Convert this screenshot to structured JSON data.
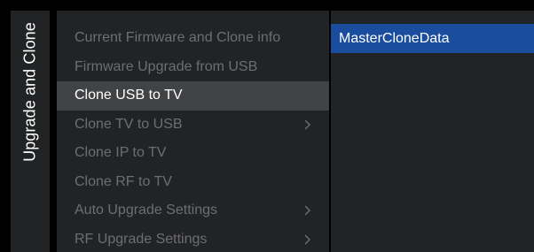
{
  "section_title": "Upgrade and Clone",
  "menu": {
    "items": [
      {
        "label": "Current Firmware and Clone info",
        "has_submenu": false,
        "selected": false
      },
      {
        "label": "Firmware Upgrade from USB",
        "has_submenu": false,
        "selected": false
      },
      {
        "label": "Clone USB to TV",
        "has_submenu": false,
        "selected": true
      },
      {
        "label": "Clone TV to USB",
        "has_submenu": true,
        "selected": false
      },
      {
        "label": "Clone IP to TV",
        "has_submenu": false,
        "selected": false
      },
      {
        "label": "Clone RF to TV",
        "has_submenu": false,
        "selected": false
      },
      {
        "label": "Auto Upgrade Settings",
        "has_submenu": true,
        "selected": false
      },
      {
        "label": "RF Upgrade Settings",
        "has_submenu": true,
        "selected": false
      }
    ]
  },
  "submenu": {
    "items": [
      {
        "label": "MasterCloneData",
        "highlighted": true
      }
    ]
  },
  "colors": {
    "background": "#000000",
    "panel": "#222324",
    "selected_row": "#424345",
    "highlight": "#1a4d9e",
    "text_active": "#ffffff",
    "text_dim": "#6d6e70"
  },
  "icons": {
    "submenu_indicator": "chevron-right-icon"
  }
}
